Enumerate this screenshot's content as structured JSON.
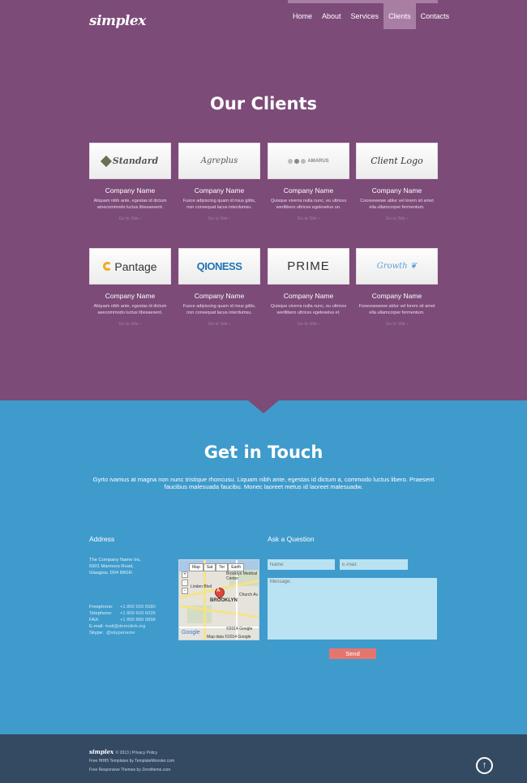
{
  "header": {
    "logo": "simplex",
    "nav": [
      "Home",
      "About",
      "Services",
      "Clients",
      "Contacts"
    ],
    "active_nav": "Clients"
  },
  "clients_section": {
    "title": "Our Clients",
    "clients": [
      {
        "logo_text": "Standard",
        "logo_icon": "standard-logo-mark",
        "name": "Company Name",
        "desc": "Aliquam nibh ante, egestas id dictum amecommodo luctus libesaesent.",
        "link": "Go to Site"
      },
      {
        "logo_text": "Agreplus",
        "logo_icon": "script-logo",
        "name": "Company Name",
        "desc": "Fusce adipiscing quam id risus gittis, non consequat lacus interdumsu.",
        "link": "Go to Site"
      },
      {
        "logo_text": "AMARUS",
        "logo_icon": "circles-logo",
        "name": "Company Name",
        "desc": "Quisque viverra nulla nunc, eu ultrices wertlibero ultrices egeleselus un.",
        "link": "Go to Site"
      },
      {
        "logo_text": "Client Logo",
        "logo_icon": "script-logo",
        "name": "Company Name",
        "desc": "Cooreewewe ablur vel lorem sit amet elia ullamcorper fermentum.",
        "link": "Go to Site"
      },
      {
        "logo_text": "Pantage",
        "logo_icon": "ring-logo",
        "name": "Company Name",
        "desc": "Aliquam nibh ante, egestas id dictum aeecommodo luctus libesaesent.",
        "link": "Go to Site"
      },
      {
        "logo_text": "QIONESS",
        "logo_icon": "text-logo",
        "name": "Company Name",
        "desc": "Fusce adipiscing quam id risus gittis, non consequat lacus interdumsu.",
        "link": "Go to Site"
      },
      {
        "logo_text": "PRIME",
        "logo_icon": "text-logo",
        "name": "Company Name",
        "desc": "Quisque viverra nulla nunc, eu ultrices wertlibero ultrices egeleselus el.",
        "link": "Go to Site"
      },
      {
        "logo_text": "Growth",
        "logo_icon": "leaf-logo",
        "name": "Company Name",
        "desc": "Fooesoeweew ablur vel lorem sit amet ella ullamcorper fermentum.",
        "link": "Go to Site"
      }
    ]
  },
  "contact_section": {
    "title": "Get in Touch",
    "text": "Gyrto ivamus at magna non nunc tristique rhoncusu. Liquam nibh ante, egestas id dictum a, commodo luctus libero. Praesent faucibus malesuada faucibu. Monec laoreet metus id laoreet malesuadw.",
    "address_heading": "Address",
    "address_lines": [
      "The Company Name Inc.",
      "5901 Marmora Road,",
      "Glasgow, D04 89GR."
    ],
    "contacts": [
      {
        "label": "Freephone:",
        "value": "+1 800 559 6580"
      },
      {
        "label": "Telephone:",
        "value": "+1 800 603 6035"
      },
      {
        "label": "FAX:",
        "value": "+1 800 889 9898"
      },
      {
        "label": "E-mail:",
        "value": "mail@demolink.org"
      },
      {
        "label": "Skype:",
        "value": "@skypename"
      }
    ],
    "map": {
      "buttons": [
        "Map",
        "Sat",
        "Ter",
        "Earth"
      ],
      "pin_letter": "A",
      "labels": [
        "Brooklyn Medical Center",
        "Linden Blvd",
        "BROOKLYN",
        "Church Av",
        "Google",
        "©2014 Google",
        "Map data ©2014 Google"
      ]
    },
    "question_heading": "Ask a Question",
    "form": {
      "name_placeholder": "Name:",
      "email_placeholder": "E-mail:",
      "message_placeholder": "Message:",
      "send_label": "Send"
    }
  },
  "footer": {
    "logo": "simplex",
    "copyright": "© 2013 | Privacy Policy",
    "line2": "Free HtHl5 Templates by TemplateMonster.com",
    "line3": "Free Responsive Themes by Zerotheme.com",
    "up_icon": "arrow-up-circle-icon"
  }
}
